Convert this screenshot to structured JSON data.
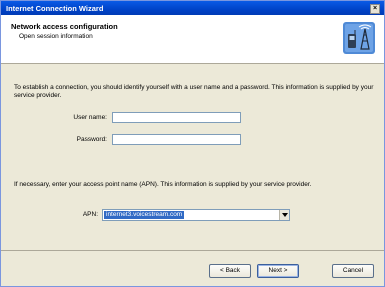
{
  "window": {
    "title": "Internet Connection Wizard",
    "close_glyph": "×"
  },
  "header": {
    "title": "Network access configuration",
    "subtitle": "Open session information",
    "icon": "phone-antenna-icon"
  },
  "intro_text": "To establish a connection, you should identify yourself with a user name and a password. This information is supplied by your service provider.",
  "fields": {
    "username_label": "User name:",
    "username_value": "",
    "password_label": "Password:",
    "password_value": ""
  },
  "apn_text": "If necessary, enter your access point name (APN). This information is supplied by your service provider.",
  "apn": {
    "label": "APN:",
    "value": "internet3.voicestream.com"
  },
  "buttons": {
    "back": "< Back",
    "next": "Next >",
    "cancel": "Cancel"
  },
  "colors": {
    "titlebar": "#0a5ae6",
    "selection": "#316ac5",
    "dialog_bg": "#ece9d8"
  }
}
